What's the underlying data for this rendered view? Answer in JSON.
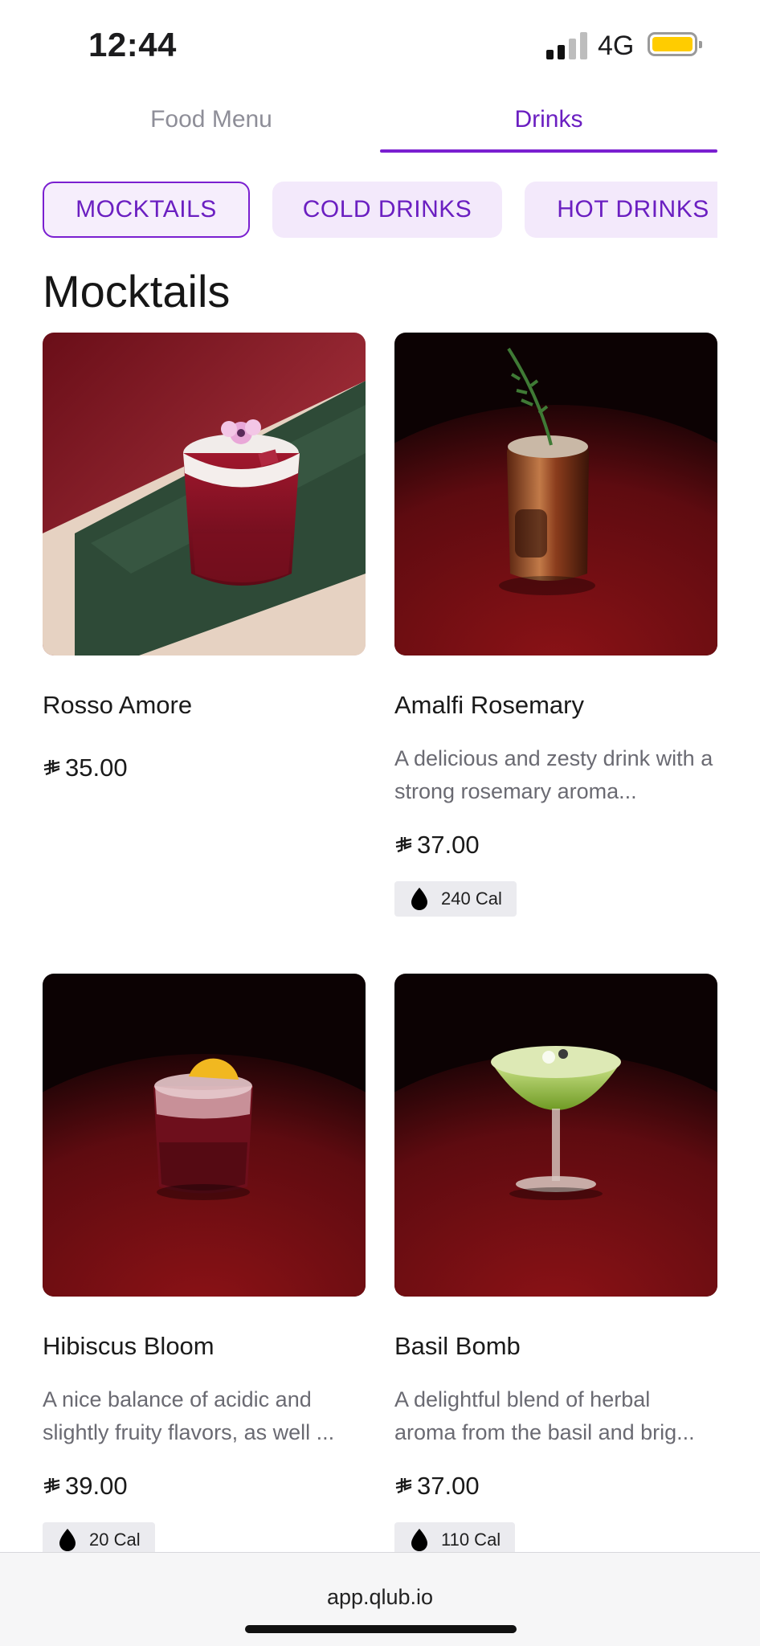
{
  "status_bar": {
    "time": "12:44",
    "network": "4G",
    "battery_color": "#ffcc00"
  },
  "tabs": [
    {
      "label": "Food Menu",
      "active": false
    },
    {
      "label": "Drinks",
      "active": true
    }
  ],
  "categories": [
    {
      "label": "MOCKTAILS",
      "active": true
    },
    {
      "label": "COLD DRINKS",
      "active": false
    },
    {
      "label": "HOT DRINKS",
      "active": false
    }
  ],
  "section_title": "Mocktails",
  "items": [
    {
      "name": "Rosso Amore",
      "description": "",
      "price": "35.00",
      "calories": ""
    },
    {
      "name": "Amalfi Rosemary",
      "description": "A delicious and zesty drink with a strong rosemary aroma...",
      "price": "37.00",
      "calories": "240 Cal"
    },
    {
      "name": "Hibiscus Bloom",
      "description": "A nice balance of acidic and slightly fruity flavors, as well ...",
      "price": "39.00",
      "calories": "20 Cal"
    },
    {
      "name": "Basil Bomb",
      "description": "A delightful blend of herbal aroma from the basil and brig...",
      "price": "37.00",
      "calories": "110 Cal"
    }
  ],
  "browser": {
    "url": "app.qlub.io"
  },
  "colors": {
    "accent": "#7a1fd0",
    "chip_bg": "#f3e9fb"
  },
  "icons": {
    "currency": "saudi-riyal-icon",
    "calories": "flame-drop-icon"
  }
}
